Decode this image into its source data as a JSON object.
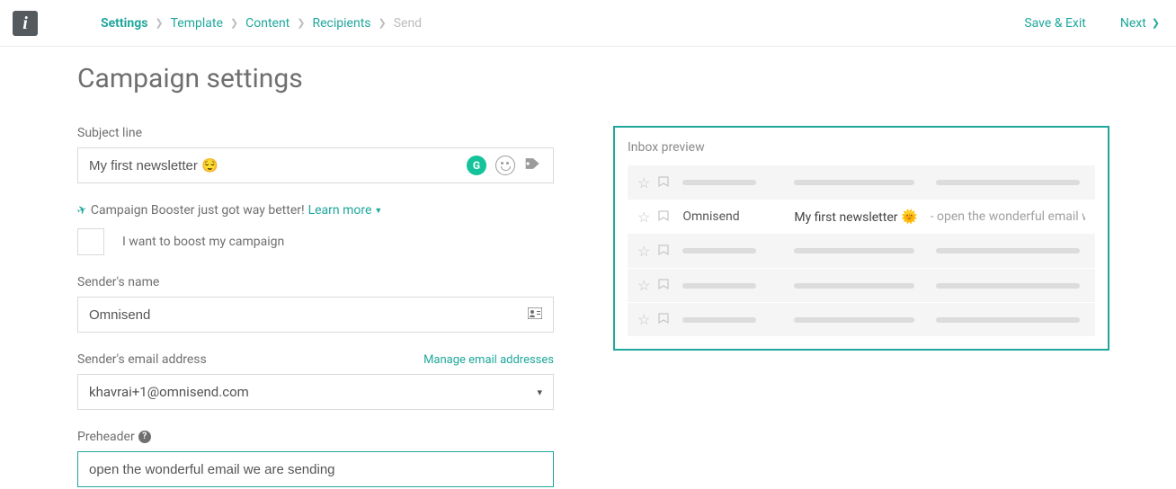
{
  "brand": "i",
  "breadcrumbs": {
    "items": [
      {
        "label": "Settings",
        "active": true,
        "disabled": false
      },
      {
        "label": "Template",
        "active": false,
        "disabled": false
      },
      {
        "label": "Content",
        "active": false,
        "disabled": false
      },
      {
        "label": "Recipients",
        "active": false,
        "disabled": false
      },
      {
        "label": "Send",
        "active": false,
        "disabled": true
      }
    ]
  },
  "actions": {
    "save_exit": "Save & Exit",
    "next": "Next"
  },
  "page_title": "Campaign settings",
  "form": {
    "subject": {
      "label": "Subject line",
      "value": "My first newsletter 😌"
    },
    "booster": {
      "text": "Campaign Booster just got way better!",
      "learn_more": "Learn more",
      "checkbox_label": "I want to boost my campaign"
    },
    "sender_name": {
      "label": "Sender's name",
      "value": "Omnisend"
    },
    "sender_email": {
      "label": "Sender's email address",
      "manage_link": "Manage email addresses",
      "value": "khavrai+1@omnisend.com"
    },
    "preheader": {
      "label": "Preheader",
      "value": "open the wonderful email we are sending"
    }
  },
  "preview": {
    "title": "Inbox preview",
    "sender": "Omnisend",
    "subject_plain": "My first newsletter",
    "subject_emoji": "🌞",
    "body_snippet": "- open the wonderful email we a..."
  }
}
